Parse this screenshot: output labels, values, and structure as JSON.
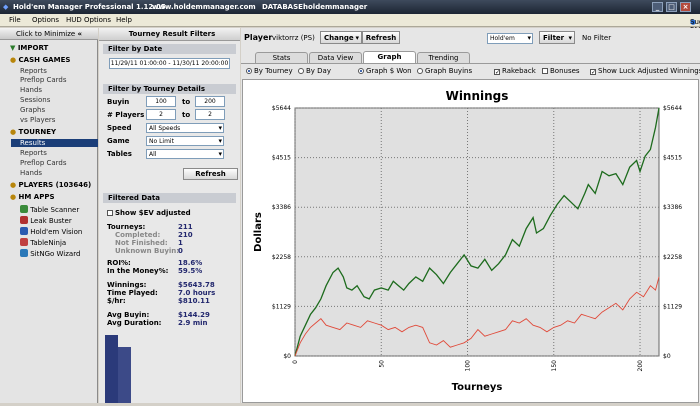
{
  "app": {
    "title": "Hold'em Manager Professional 1.12.05",
    "website": "www.holdemmanager.com",
    "database_label": "DATABASE:",
    "database_name": "holdemmanager"
  },
  "menu": {
    "items": [
      "File",
      "Options",
      "HUD Options",
      "Help"
    ],
    "suggested": "Suggested FAQs (8)"
  },
  "sidebar": {
    "minimize": "Click to Minimize",
    "import": "IMPORT",
    "cash_games": "CASH GAMES",
    "cash_items": [
      "Reports",
      "Preflop Cards",
      "Hands",
      "Sessions",
      "Graphs",
      "vs Players"
    ],
    "tourney": "TOURNEY",
    "tourney_items": [
      "Results",
      "Reports",
      "Preflop Cards",
      "Hands"
    ],
    "players": "PLAYERS (103646)",
    "hm_apps": "HM APPS",
    "apps": [
      "Table Scanner",
      "Leak Buster",
      "Hold'em Vision",
      "TableNinja",
      "SitNGo Wizard"
    ]
  },
  "filters": {
    "header": "Tourney Result Filters",
    "by_date": "Filter by Date",
    "date_range": "11/29/11 01:00:00 - 11/30/11 20:00:00",
    "by_details": "Filter by Tourney Details",
    "buyin_label": "Buyin",
    "buyin_min": "100",
    "buyin_max": "200",
    "players_label": "# Players",
    "players_min": "2",
    "players_max": "2",
    "to": "to",
    "speed_label": "Speed",
    "speed_value": "All Speeds",
    "game_label": "Game",
    "game_value": "No Limit",
    "tables_label": "Tables",
    "tables_value": "All",
    "refresh": "Refresh"
  },
  "filtered": {
    "header": "Filtered Data",
    "show_ev": "Show $EV adjusted",
    "tourneys_label": "Tourneys:",
    "tourneys": "211",
    "completed_label": "Completed:",
    "completed": "210",
    "not_finished_label": "Not Finished:",
    "not_finished": "1",
    "unknown_label": "Unknown Buyin:",
    "unknown": "0",
    "roi_label": "ROI%:",
    "roi": "18.6%",
    "itm_label": "In the Money%:",
    "itm": "59.5%",
    "winnings_label": "Winnings:",
    "winnings": "$5643.78",
    "time_label": "Time Played:",
    "time": "7.0 hours",
    "hr_label": "$/hr:",
    "hr": "$810.11",
    "avg_buyin_label": "Avg Buyin:",
    "avg_buyin": "$144.29",
    "avg_dur_label": "Avg Duration:",
    "avg_dur": "2.9 min"
  },
  "player_bar": {
    "label": "Player",
    "name": "viktorrz (PS)",
    "change": "Change",
    "refresh": "Refresh",
    "game": "Hold'em",
    "filter": "Filter",
    "filter_value": "No Filter"
  },
  "tabs": [
    "Stats",
    "Data View",
    "Graph",
    "Trending"
  ],
  "options": {
    "by_tourney": "By Tourney",
    "by_day": "By Day",
    "graph_won": "Graph $ Won",
    "graph_buyins": "Graph Buyins",
    "rakeback": "Rakeback",
    "bonuses": "Bonuses",
    "show_luck": "Show Luck Adjusted Winnings"
  },
  "colors": {
    "title_bar": "#1c2533",
    "selection": "#1b3e78",
    "winnings_line": "#1d6b1d",
    "luck_line": "#e04a3a",
    "plot_bg": "#e0e0e0"
  },
  "chart_data": {
    "type": "line",
    "title": "Winnings",
    "xlabel": "Tourneys",
    "ylabel": "Dollars",
    "ylim": [
      0,
      5644
    ],
    "xlim": [
      0,
      211
    ],
    "y_ticks": [
      "$0",
      "$1129",
      "$2258",
      "$3386",
      "$4515",
      "$5644"
    ],
    "x_ticks": [
      "0",
      "50",
      "100",
      "150",
      "200"
    ],
    "grid": true,
    "series": [
      {
        "x": [
          0,
          3,
          6,
          9,
          12,
          15,
          18,
          22,
          25,
          28,
          30,
          33,
          36,
          40,
          43,
          46,
          50,
          54,
          57,
          60,
          63,
          66,
          70,
          74,
          78,
          82,
          86,
          90,
          94,
          98,
          102,
          106,
          110,
          114,
          118,
          122,
          126,
          130,
          134,
          138,
          140,
          144,
          148,
          152,
          156,
          160,
          164,
          168,
          170,
          174,
          178,
          182,
          186,
          190,
          194,
          198,
          200,
          203,
          206,
          209,
          211
        ],
        "y": [
          0,
          450,
          700,
          950,
          1100,
          1300,
          1600,
          1900,
          2000,
          1800,
          1550,
          1500,
          1600,
          1350,
          1300,
          1500,
          1550,
          1500,
          1700,
          1600,
          1500,
          1650,
          1800,
          1700,
          2000,
          1850,
          1650,
          1900,
          2100,
          2300,
          2050,
          2000,
          2200,
          1950,
          2100,
          2300,
          2650,
          2500,
          2900,
          3150,
          2800,
          2900,
          3200,
          3450,
          3650,
          3500,
          3350,
          3700,
          3900,
          3700,
          4200,
          4100,
          4150,
          3900,
          4300,
          4450,
          4200,
          4550,
          4700,
          5200,
          5644
        ]
      },
      {
        "x": [
          0,
          3,
          6,
          9,
          12,
          15,
          18,
          22,
          26,
          30,
          34,
          38,
          42,
          46,
          50,
          54,
          58,
          62,
          66,
          70,
          74,
          78,
          82,
          86,
          90,
          94,
          98,
          102,
          106,
          110,
          114,
          118,
          122,
          126,
          130,
          134,
          138,
          142,
          146,
          150,
          154,
          158,
          162,
          166,
          170,
          174,
          178,
          182,
          186,
          190,
          194,
          198,
          202,
          206,
          209,
          211
        ],
        "y": [
          0,
          300,
          500,
          650,
          750,
          850,
          700,
          650,
          600,
          750,
          700,
          650,
          800,
          750,
          700,
          600,
          650,
          550,
          650,
          700,
          650,
          300,
          250,
          350,
          200,
          250,
          300,
          400,
          600,
          450,
          500,
          550,
          600,
          800,
          750,
          850,
          700,
          650,
          550,
          650,
          700,
          800,
          750,
          950,
          900,
          850,
          1000,
          1100,
          1200,
          1050,
          1300,
          1450,
          1350,
          1600,
          1500,
          1800
        ]
      }
    ]
  }
}
